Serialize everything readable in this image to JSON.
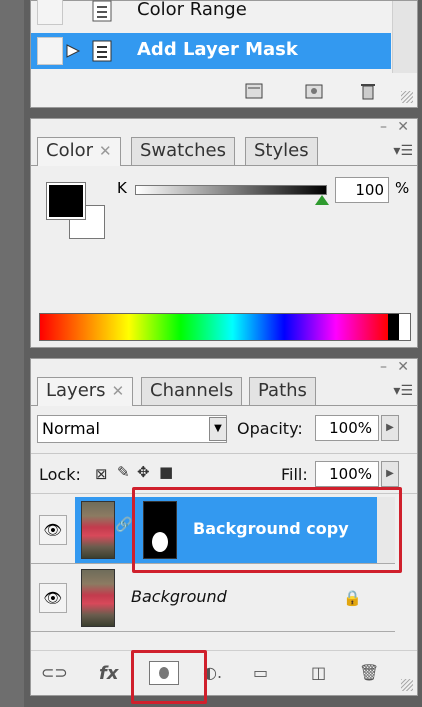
{
  "actions": {
    "items": [
      {
        "label": "Color Range"
      },
      {
        "label": "Add Layer Mask",
        "selected": true
      }
    ],
    "toolbar_icons": [
      "new-set-icon",
      "new-action-icon",
      "trash-icon"
    ]
  },
  "color_panel": {
    "tabs": [
      "Color",
      "Swatches",
      "Styles"
    ],
    "active_tab": "Color",
    "channel_label": "K",
    "channel_value": "100",
    "channel_unit": "%",
    "foreground": "#000000",
    "background": "#ffffff"
  },
  "layers_panel": {
    "tabs": [
      "Layers",
      "Channels",
      "Paths"
    ],
    "active_tab": "Layers",
    "blend_mode": "Normal",
    "opacity_label": "Opacity:",
    "opacity_value": "100%",
    "lock_label": "Lock:",
    "fill_label": "Fill:",
    "fill_value": "100%",
    "layers": [
      {
        "name": "Background copy",
        "selected": true,
        "has_mask": true
      },
      {
        "name": "Background",
        "locked": true
      }
    ],
    "bottom_icons": [
      "link-icon",
      "fx-icon",
      "layer-mask-icon",
      "adjustment-icon",
      "folder-icon",
      "new-layer-icon",
      "trash-icon"
    ]
  },
  "colors": {
    "selection_blue": "#3399f0",
    "highlight_red": "#d0202c",
    "panel_bg": "#efefef"
  }
}
